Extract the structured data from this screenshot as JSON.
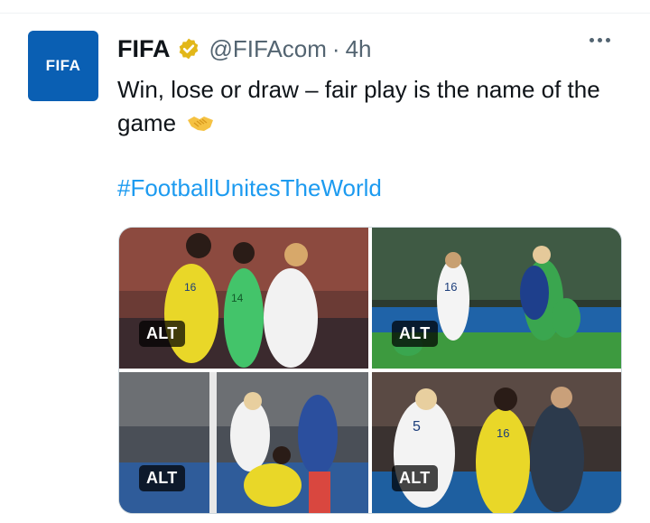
{
  "tweet": {
    "author_name": "FIFA",
    "author_handle": "@FIFAcom",
    "separator": "·",
    "time": "4h",
    "avatar_text": "FIFA",
    "text": "Win, lose or draw – fair play is the name of the game",
    "hashtag": "#FootballUnitesTheWorld"
  },
  "media": {
    "alt_label": "ALT"
  },
  "colors": {
    "link": "#1d9bf0",
    "muted": "#536471",
    "avatar_bg": "#0a5fb3",
    "verified": "#e2b719"
  },
  "icons": [
    "verified-badge-icon",
    "more-icon",
    "handshake-emoji-icon"
  ]
}
